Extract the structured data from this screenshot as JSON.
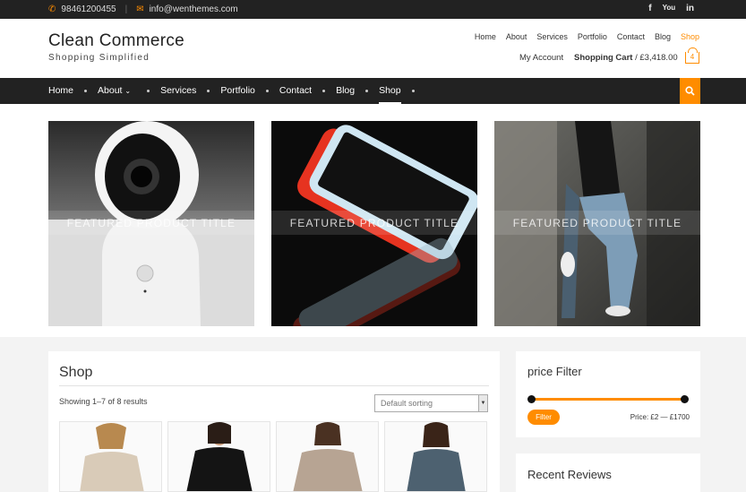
{
  "topbar": {
    "phone": "98461200455",
    "email": "info@wenthemes.com",
    "social": [
      "f",
      "You",
      "in"
    ]
  },
  "site": {
    "title": "Clean Commerce",
    "tagline": "Shopping Simplified"
  },
  "top_nav": [
    "Home",
    "About",
    "Services",
    "Portfolio",
    "Contact",
    "Blog",
    "Shop"
  ],
  "account": {
    "my_account": "My Account",
    "cart_label": "Shopping Cart",
    "cart_total": " / £3,418.00",
    "cart_count": "4"
  },
  "main_nav": [
    "Home",
    "About",
    "Services",
    "Portfolio",
    "Contact",
    "Blog",
    "Shop"
  ],
  "featured": [
    {
      "title": "FEATURED PRODUCT TITLE"
    },
    {
      "title": "FEATURED PRODUCT TITLE"
    },
    {
      "title": "FEATURED PRODUCT TITLE"
    }
  ],
  "shop": {
    "title": "Shop",
    "result_count": "Showing 1–7 of 8 results",
    "sort_value": "Default sorting"
  },
  "sidebar": {
    "price_filter_title": "price Filter",
    "filter_button": "Filter",
    "price_range": "Price: £2 — £1700",
    "price_min": 2,
    "price_max": 1700,
    "recent_reviews_title": "Recent Reviews"
  },
  "colors": {
    "accent": "#ff8c00",
    "dark_bar": "#222222"
  }
}
